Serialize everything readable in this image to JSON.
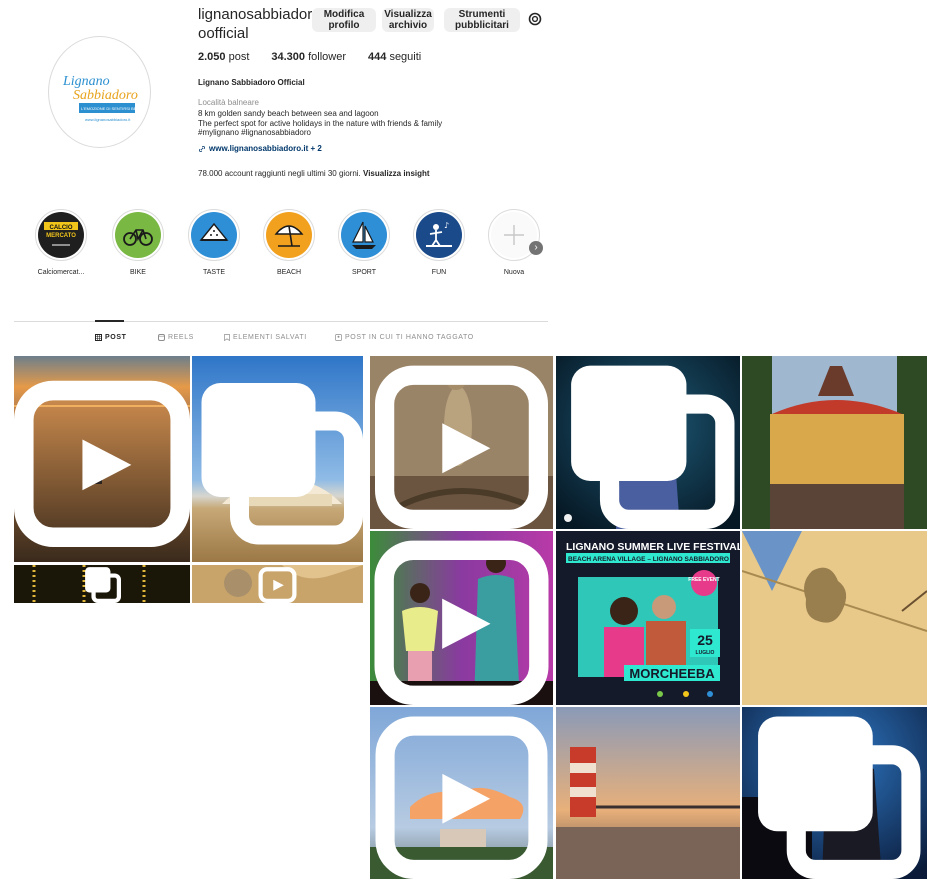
{
  "profile": {
    "username": "lignanosabbiadoroofficial",
    "full_name": "Lignano Sabbiadoro Official",
    "category": "Località balneare",
    "bio": [
      "8 km golden sandy beach between sea and lagoon",
      "The perfect spot for active holidays in the nature with friends & family",
      "#mylignano #lignanosabbiadoro"
    ],
    "link_text": "www.lignanosabbiadoro.it + 2",
    "avatar_logo_line1": "Lignano",
    "avatar_logo_line2": "Sabbiadoro",
    "avatar_tagline": "L'EMOZIONE DI SENTIRSI BENE",
    "avatar_url": "www.lignanosabbiadoro.it"
  },
  "actions": {
    "edit": "Modifica profilo",
    "archive": "Visualizza archivio",
    "ads": "Strumenti pubblicitari"
  },
  "stats": {
    "posts_value": "2.050",
    "posts_label": "post",
    "followers_value": "34.300",
    "followers_label": "follower",
    "following_value": "444",
    "following_label": "seguiti"
  },
  "insight": {
    "text": "78.000 account raggiunti negli ultimi 30 giorni.",
    "link": "Visualizza insight"
  },
  "highlights": [
    {
      "label": "Calciomercat...",
      "icon": "calcio-mercato",
      "bg": "#1f1f1f",
      "top": "CALCIO",
      "bottom": "MERCATO"
    },
    {
      "label": "BIKE",
      "icon": "bike-icon",
      "bg": "#79b843"
    },
    {
      "label": "TASTE",
      "icon": "watermelon-icon",
      "bg": "#2f8fd6"
    },
    {
      "label": "BEACH",
      "icon": "umbrella-icon",
      "bg": "#f2a11f"
    },
    {
      "label": "SPORT",
      "icon": "sailboat-icon",
      "bg": "#2f8fd6"
    },
    {
      "label": "FUN",
      "icon": "dj-icon",
      "bg": "#1a4a8a"
    },
    {
      "label": "Nuova",
      "icon": "plus-icon",
      "bg": "#fafafa"
    }
  ],
  "tabs": {
    "post": "POST",
    "reels": "REELS",
    "saved": "ELEMENTI SALVATI",
    "tagged": "POST IN CUI TI HANNO TAGGATO"
  },
  "posters": {
    "festival_title": "LIGNANO SUMMER LIVE FESTIVAL",
    "festival_venue": "BEACH ARENA VILLAGE – LIGNANO SABBIADORO",
    "free_event": "FREE EVENT",
    "day": "25",
    "month": "LUGLIO",
    "artist": "MORCHEEBA"
  },
  "colors": {
    "link": "#00376b",
    "muted": "#8e8e8e",
    "border": "#dbdbdb",
    "button_bg": "#efefef"
  }
}
